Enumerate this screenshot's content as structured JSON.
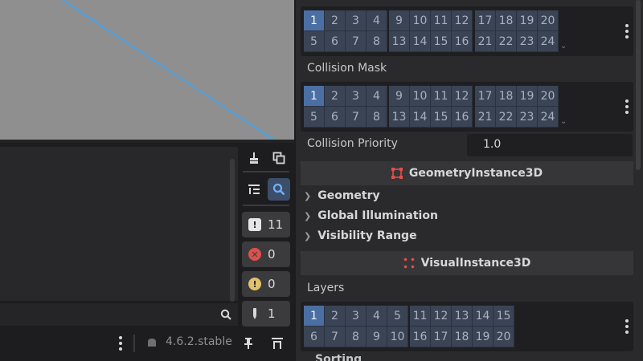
{
  "output": {
    "counts": {
      "messages": "11",
      "errors": "0",
      "warnings": "0",
      "debug": "1"
    }
  },
  "status": {
    "version": "4.6.2.stable"
  },
  "inspector": {
    "collision_layer": {
      "groups": [
        [
          "1",
          "2",
          "3",
          "4",
          "5",
          "6",
          "7",
          "8"
        ],
        [
          "9",
          "10",
          "11",
          "12",
          "13",
          "14",
          "15",
          "16"
        ],
        [
          "17",
          "18",
          "19",
          "20",
          "21",
          "22",
          "23",
          "24"
        ]
      ],
      "active": [
        "1"
      ]
    },
    "collision_mask": {
      "label": "Collision Mask",
      "groups": [
        [
          "1",
          "2",
          "3",
          "4",
          "5",
          "6",
          "7",
          "8"
        ],
        [
          "9",
          "10",
          "11",
          "12",
          "13",
          "14",
          "15",
          "16"
        ],
        [
          "17",
          "18",
          "19",
          "20",
          "21",
          "22",
          "23",
          "24"
        ]
      ],
      "active": [
        "1"
      ]
    },
    "collision_priority": {
      "label": "Collision Priority",
      "value": "1.0"
    },
    "geometry_section": {
      "title": "GeometryInstance3D",
      "groups": [
        "Geometry",
        "Global Illumination",
        "Visibility Range"
      ]
    },
    "visual_section": {
      "title": "VisualInstance3D"
    },
    "layers": {
      "label": "Layers",
      "groups": [
        [
          "1",
          "2",
          "3",
          "4",
          "5",
          "6",
          "7",
          "8",
          "9",
          "10"
        ],
        [
          "11",
          "12",
          "13",
          "14",
          "15",
          "16",
          "17",
          "18",
          "19",
          "20"
        ]
      ],
      "active": [
        "1"
      ]
    },
    "cut_off_label": "Sorting"
  },
  "colors": {
    "accent": "#4b6fa3",
    "error": "#e0504b",
    "warning": "#e3c16b",
    "line": "#4aa3e8",
    "section_icon": "#e0504b"
  }
}
